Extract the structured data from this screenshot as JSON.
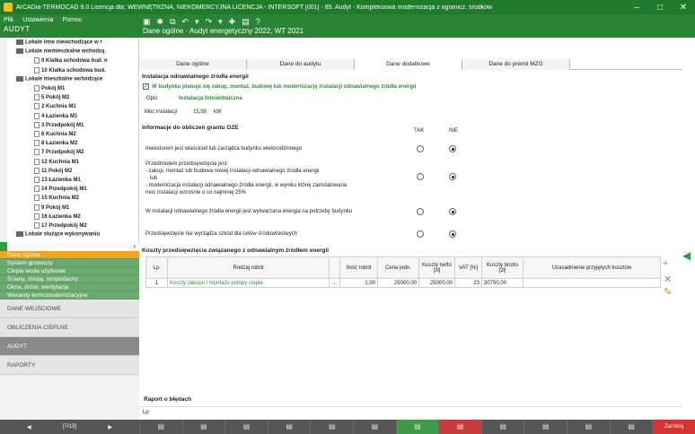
{
  "window": {
    "title": "ArCADia-TERMOCAD 9.0 Licencja dla: WEWNĘTRZNA, NIEKOMERCYJNA LICENCJA - INTERSOFT [001] - 85. Audyt - Kompleksowa modernizacja z ogranicz. środków",
    "minimize": "–",
    "maximize": "□",
    "close": "✕"
  },
  "menu": {
    "items": [
      "Plik",
      "Ustawienia",
      "Pomoc"
    ],
    "app_label": "AUDYT"
  },
  "toolbar": {
    "breadcrumb": "Dane ogólne · Audyt energetyczny 2022, WT 2021"
  },
  "tree": {
    "nodes": [
      "Lokale inne niewchodzące w r",
      "Lokale niemieszkalne wchodzą",
      "0 Klatka schodowa bud. n",
      "10 Klatka schodowa bud.",
      "Lokale mieszkalne wchodzące",
      "Pokój M1",
      "5 Pokój M2",
      "2 Kuchnia M1",
      "4 Łazienka M1",
      "3 Przedpokój M1",
      "6 Kuchnia M2",
      "8 Łazienka M2",
      "7 Przedpokój M2",
      "12 Kuchnia M1",
      "11 Pokój M2",
      "13 Łazienka M1",
      "14 Przedpokój M1",
      "15 Kuchnia M2",
      "9 Pokój M1",
      "16 Łazienka M2",
      "17 Przedpokój M2",
      "Lokale służące wykonywaniu"
    ]
  },
  "nav": {
    "items": [
      "Dane ogólne",
      "System grzewczy",
      "Ciepła woda użytkowa",
      "Ściany, stropy, stropodachy",
      "Okna, drzwi, wentylacja",
      "Warianty termomodernizacyjne"
    ],
    "big_items": [
      "DANE WEJŚCIOWE",
      "OBLICZENIA CIEPLNE",
      "AUDYT",
      "RAPORTY"
    ]
  },
  "tabs": [
    "Dane ogólne",
    "Dane do audytu",
    "Dane dodatkowe",
    "Dane do premii MZG"
  ],
  "form": {
    "section1": "Instalacja odnawialnego źródła energii",
    "checkbox_label": "W budynku planuje się zakup, montaż, budowę lub modernizację instalacji odnawialnego źródła energii",
    "opis_label": "Opis",
    "opis_value": "Instalacja fotowoltaiczna",
    "moc_label": "Moc instalacji",
    "moc_value": "15,00",
    "moc_unit": "kW",
    "section2": "Informacje do obliczeń grantu OZE",
    "col_tak": "TAK",
    "col_nie": "NIE",
    "q1": "Inwestorem jest właściciel lub zarządca budynku wielorodzinnego",
    "q2_lines": [
      "Przedmiotem przedsięwzięcia jest:",
      "- zakup, montaż lub budowa nowej instalacji odnawialnego źródła energii",
      "lub",
      "- modernizacja instalacji odnawialnego źródła energii, w wyniku której zainstalowana",
      "moc instalacji wzrośnie o co najmniej 25%"
    ],
    "q3": "W instalacji odnawialnego źródła energii jest wytwarzana energia na potrzeby budynku",
    "q4": "Przedsięwzięcie nie wyrządza szkód dla celów środowiskowych",
    "section3": "Koszty przedsięwzięcia związanego z odnawialnym źródłem energii"
  },
  "table": {
    "headers": [
      "Lp.",
      "Rodzaj robót",
      "",
      "Ilość robót",
      "Cena jedn.",
      "Koszty netto [zł]",
      "VAT [%]",
      "Koszty brutto [zł]",
      "Uzasadnienie przyjętych kosztów"
    ],
    "rows": [
      [
        "1",
        "Koszty zakupu i montażu pompy ciepła",
        "...",
        "1,00",
        "25000,00",
        "25000,00",
        "23",
        "30750,00",
        ""
      ]
    ]
  },
  "raport": {
    "label": "Raport o błędach",
    "col": "Lp"
  },
  "footer": {
    "page": "[7/13]",
    "close": "Zamknij"
  },
  "colors": {
    "titlebar": "#1f7a2b",
    "menubar": "#2a8436",
    "nav_item": "#6ca96f",
    "nav_selected": "#f2a41d"
  }
}
